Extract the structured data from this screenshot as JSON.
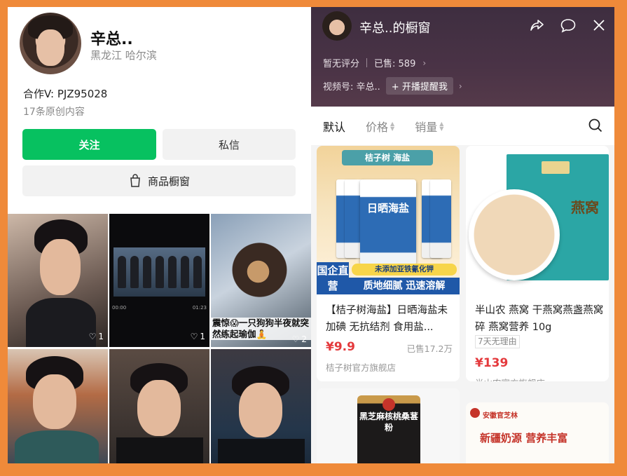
{
  "profile": {
    "name": "辛总..",
    "location": "黑龙江 哈尔滨",
    "partner": "合作V: PJZ95028",
    "original_count": "17条原创内容",
    "follow_label": "关注",
    "message_label": "私信",
    "shop_label": "商品橱窗"
  },
  "videos": [
    {
      "likes": "1"
    },
    {
      "likes": "1",
      "player_time_left": "00:00",
      "player_time_right": "01:23"
    },
    {
      "likes": "2",
      "caption": "震惊😱一只狗狗半夜就突然练起瑜伽🧘"
    },
    {},
    {},
    {}
  ],
  "shop": {
    "title": "辛总..的橱窗",
    "rating": "暂无评分",
    "sold": "已售: 589",
    "video_account": "视频号: 辛总..",
    "remind_label": "开播提醒我",
    "tabs": [
      {
        "label": "默认",
        "active": true
      },
      {
        "label": "价格",
        "active": false
      },
      {
        "label": "销量",
        "active": false
      }
    ],
    "products": [
      {
        "banner": "桔子树 海盐",
        "package_text": "日晒海盐",
        "badge": "国企直营",
        "yellow_text": "未添加亚铁氰化钾",
        "blue_text": "质地细腻  迅速溶解",
        "title": "【桔子树海盐】日晒海盐未加碘 无抗结剂 食用盐...",
        "price": "¥9.9",
        "sold": "已售17.2万",
        "store": "桔子树官方旗舰店"
      },
      {
        "box_text": "燕窝",
        "title": "半山农 燕窝 干燕窝燕盏燕窝碎 燕窝营养 10g",
        "tag": "7天无理由",
        "price": "¥139",
        "store": "半山农官方旗舰店"
      },
      {
        "jar_text": "黑芝麻核桃桑葚粉"
      },
      {
        "brand": "安徽官芝林",
        "slogan": "新疆奶源  营养丰富"
      }
    ]
  }
}
